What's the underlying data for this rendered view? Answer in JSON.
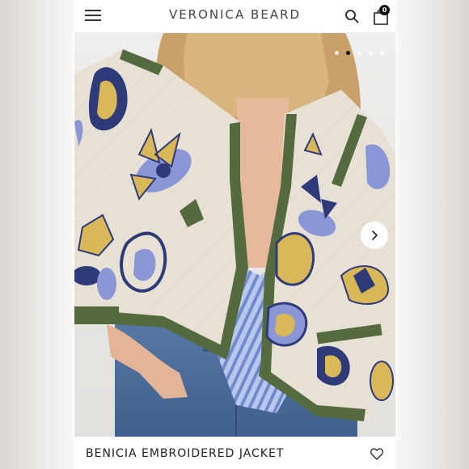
{
  "header": {
    "brand": "VERONICA BEARD",
    "menu_icon": "hamburger-menu-icon",
    "search_icon": "search-icon",
    "bag_icon": "shopping-bag-icon",
    "bag_count": "0"
  },
  "gallery": {
    "image": "Model wearing a cream quilted cropped jacket with navy, blue and gold floral embroidery and olive green trim, over a striped blue wrap top and jeans",
    "slide_count": 5,
    "active_slide": 2,
    "next_icon": "chevron-right-icon"
  },
  "product": {
    "title": "BENICIA EMBROIDERED JACKET",
    "wishlist_icon": "heart-icon"
  },
  "colors": {
    "jacket_cream": "#e6e0d4",
    "trim_olive": "#556b3f",
    "embroidery_navy": "#2f3a78",
    "embroidery_blue": "#8a96d6",
    "embroidery_gold": "#d9b85a",
    "denim": "#4a6e9c"
  }
}
